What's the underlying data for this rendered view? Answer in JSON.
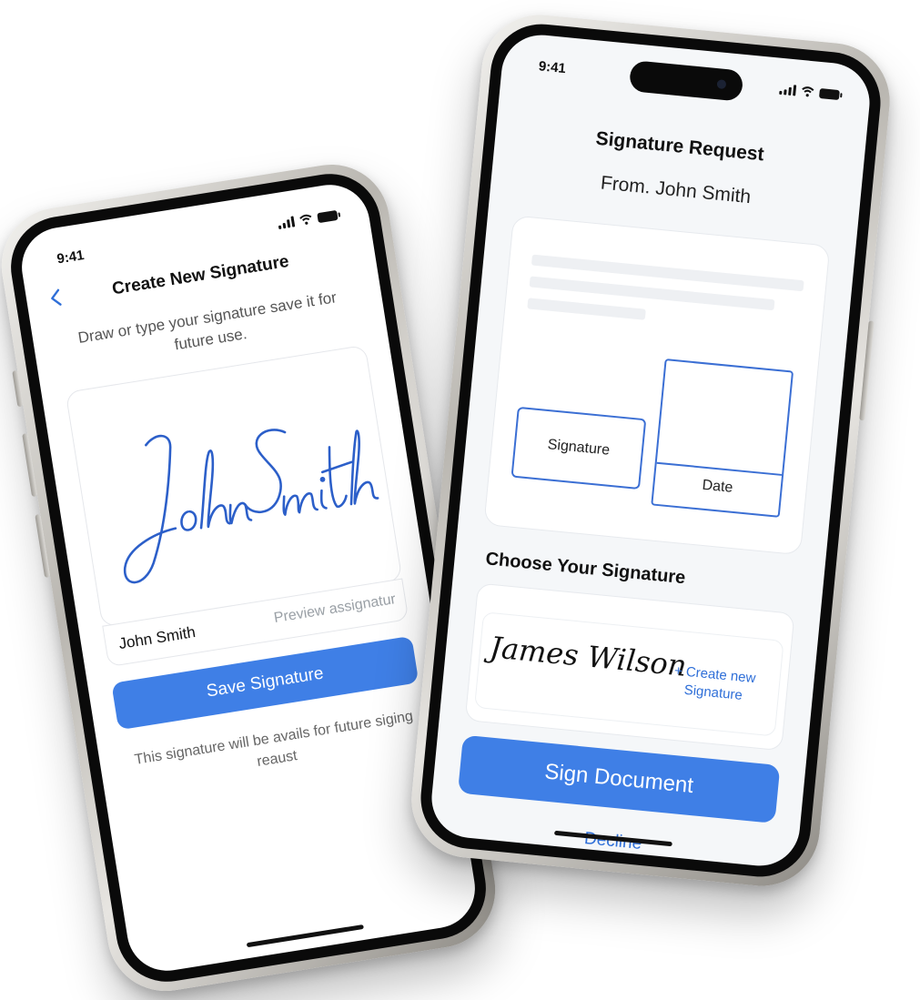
{
  "left_phone": {
    "status": {
      "time": "9:41"
    },
    "title": "Create New Signature",
    "description": "Draw or type your signature save it for future use.",
    "drawn_signature": "John Smith",
    "name_input": "John Smith",
    "preview_label": "Preview assignatur",
    "save_button": "Save Signature",
    "note": "This signature will be avails for future siging reaust"
  },
  "right_phone": {
    "status": {
      "time": "9:41"
    },
    "title": "Signature Request",
    "from": "From. John Smith",
    "document": {
      "signature_field": "Signature",
      "date_field": "Date"
    },
    "choose_title": "Choose Your Signature",
    "saved_signature": "James Wilson",
    "create_new": "+ Create new Signature",
    "sign_button": "Sign Document",
    "decline": "Decline"
  },
  "colors": {
    "accent": "#3f7fe6",
    "link": "#2f6fd8",
    "signature_ink": "#2c5fc9"
  }
}
